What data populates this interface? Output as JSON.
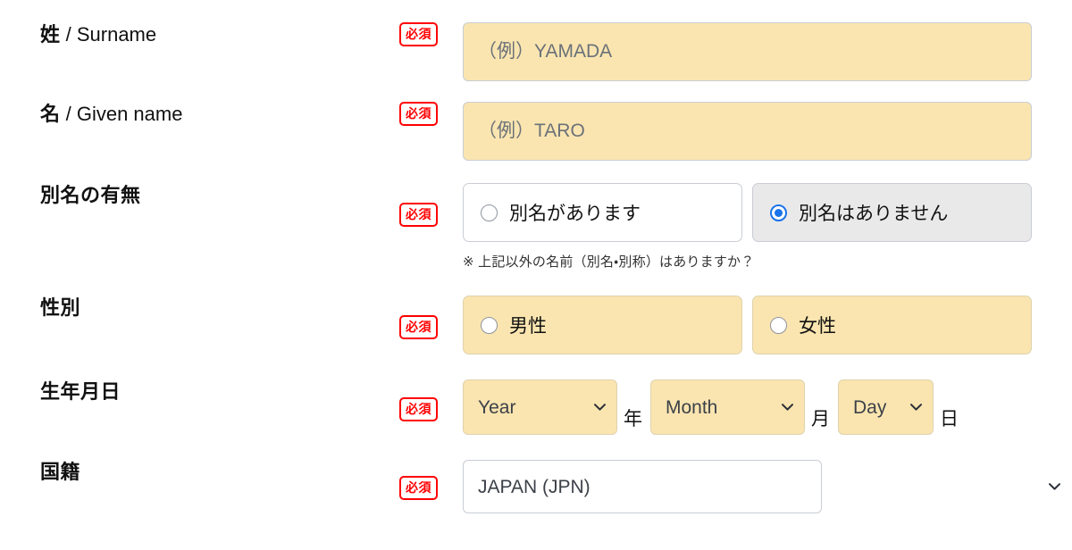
{
  "form": {
    "required_badge": "必須",
    "rows": [
      {
        "id": "surname",
        "label_jp": "姓",
        "label_en": " / Surname",
        "placeholder": "（例）YAMADA",
        "value": ""
      },
      {
        "id": "given-name",
        "label_jp": "名",
        "label_en": " / Given name",
        "placeholder": "（例）TARO",
        "value": ""
      },
      {
        "id": "alias",
        "label_jp": "別名の有無",
        "label_en": "",
        "options": [
          {
            "label": "別名があります",
            "selected": false
          },
          {
            "label": "別名はありません",
            "selected": true
          }
        ],
        "note": "※ 上記以外の名前（別名・別称）はありますか？"
      },
      {
        "id": "gender",
        "label_jp": "性別",
        "label_en": "",
        "options": [
          {
            "label": "男性",
            "selected": false
          },
          {
            "label": "女性",
            "selected": false
          }
        ]
      },
      {
        "id": "birthdate",
        "label_jp": "生年月日",
        "label_en": "",
        "year": {
          "value": "Year",
          "unit": "年"
        },
        "month": {
          "value": "Month",
          "unit": "月"
        },
        "day": {
          "value": "Day",
          "unit": "日"
        }
      },
      {
        "id": "nationality",
        "label_jp": "国籍",
        "label_en": "",
        "value": "JAPAN (JPN)"
      }
    ]
  },
  "icons": {
    "chevron": "chevron-down-icon",
    "radio": "radio-button-icon"
  },
  "colors": {
    "field_yellow": "#fae5b0",
    "selected_gray": "#e9e9ea",
    "required_red": "#ff0000",
    "radio_blue": "#1a73e8",
    "border_gray": "#c9cdd4",
    "page_bg": "#ffffff"
  }
}
